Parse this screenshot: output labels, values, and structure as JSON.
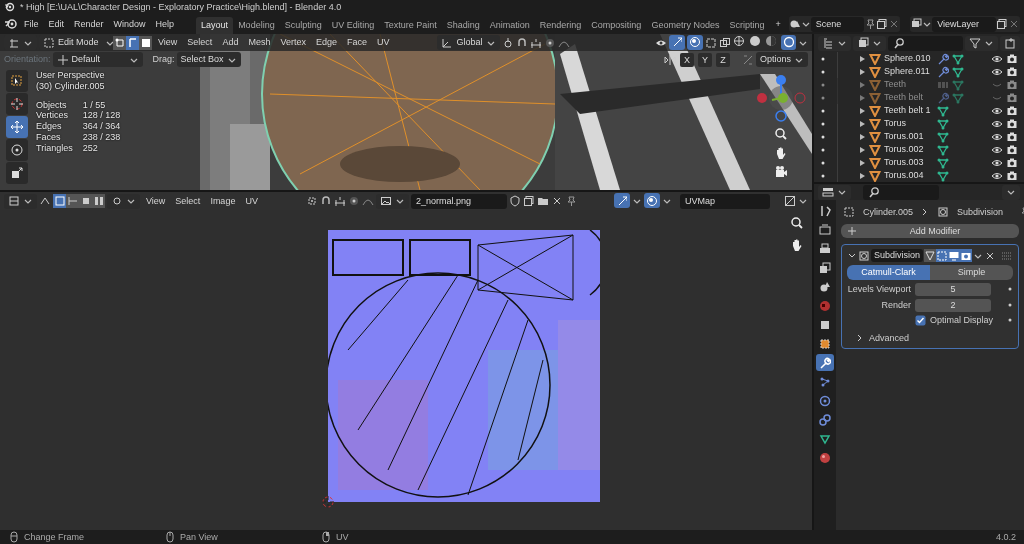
{
  "window": {
    "title": "* High [E:\\UAL\\Character Design - Exploratory Practice\\High.blend] - Blender 4.0"
  },
  "menus": [
    "File",
    "Edit",
    "Render",
    "Window",
    "Help"
  ],
  "workspaces": [
    {
      "label": "Layout",
      "selected": true
    },
    {
      "label": "Modeling",
      "selected": false
    },
    {
      "label": "Sculpting",
      "selected": false
    },
    {
      "label": "UV Editing",
      "selected": false
    },
    {
      "label": "Texture Paint",
      "selected": false
    },
    {
      "label": "Shading",
      "selected": false
    },
    {
      "label": "Animation",
      "selected": false
    },
    {
      "label": "Rendering",
      "selected": false
    },
    {
      "label": "Compositing",
      "selected": false
    },
    {
      "label": "Geometry Nodes",
      "selected": false
    },
    {
      "label": "Scripting",
      "selected": false
    }
  ],
  "add_workspace": "+",
  "scene": "Scene",
  "view_layer": "ViewLayer",
  "viewport": {
    "mode": "Edit Mode",
    "select_modes": [
      {
        "selected": false
      },
      {
        "selected": true
      },
      {
        "selected": false
      }
    ],
    "menus": [
      "View",
      "Select",
      "Add",
      "Mesh",
      "Vertex",
      "Edge",
      "Face",
      "UV"
    ],
    "transform_orientation": "Global",
    "orientation_label": "Orientation:",
    "orientation": "Default",
    "drag_label": "Drag:",
    "drag": "Select Box",
    "axes": [
      "X",
      "Y",
      "Z"
    ],
    "options": "Options",
    "view_name": "User Perspective",
    "object": "(30) Cylinder.005",
    "stats": [
      {
        "label": "Objects",
        "value": "1 / 55"
      },
      {
        "label": "Vertices",
        "value": "128 / 128"
      },
      {
        "label": "Edges",
        "value": "364 / 364"
      },
      {
        "label": "Faces",
        "value": "238 / 238"
      },
      {
        "label": "Triangles",
        "value": "252"
      }
    ],
    "tools": [
      {
        "selected": false
      },
      {
        "selected": false
      },
      {
        "selected": true
      },
      {
        "selected": false
      },
      {
        "selected": false
      }
    ]
  },
  "uv_editor": {
    "menus": [
      "View",
      "Select",
      "Image",
      "UV"
    ],
    "image": "2_normal.png",
    "uv_map": "UVMap"
  },
  "outliner": {
    "items": [
      {
        "name": "Sphere.010",
        "kind": "wrench",
        "dimmed": false,
        "visible": true
      },
      {
        "name": "Sphere.011",
        "kind": "wrench",
        "dimmed": false,
        "visible": true
      },
      {
        "name": "Teeth",
        "kind": "array",
        "dimmed": true,
        "visible": false
      },
      {
        "name": "Teeth belt",
        "kind": "wrench",
        "dimmed": true,
        "visible": false
      },
      {
        "name": "Teeth belt 1",
        "kind": "plain",
        "dimmed": false,
        "visible": true
      },
      {
        "name": "Torus",
        "kind": "plain",
        "dimmed": false,
        "visible": true
      },
      {
        "name": "Torus.001",
        "kind": "plain",
        "dimmed": false,
        "visible": true
      },
      {
        "name": "Torus.002",
        "kind": "plain",
        "dimmed": false,
        "visible": true
      },
      {
        "name": "Torus.003",
        "kind": "plain",
        "dimmed": false,
        "visible": true
      },
      {
        "name": "Torus.004",
        "kind": "plain",
        "dimmed": false,
        "visible": true
      }
    ]
  },
  "properties": {
    "tabs": [
      {
        "selected": false
      },
      {
        "selected": false
      },
      {
        "selected": false
      },
      {
        "selected": false
      },
      {
        "selected": false
      },
      {
        "selected": false
      },
      {
        "selected": false
      },
      {
        "selected": false
      },
      {
        "selected": true
      },
      {
        "selected": false
      },
      {
        "selected": false
      },
      {
        "selected": false
      },
      {
        "selected": false
      },
      {
        "selected": false
      }
    ],
    "breadcrumb": {
      "object": "Cylinder.005",
      "modifier": "Subdivision"
    },
    "add_modifier": "Add Modifier",
    "modifier": {
      "name": "Subdivision",
      "expanded": true,
      "toggles": [
        {
          "on": false
        },
        {
          "on": true
        },
        {
          "on": true
        },
        {
          "on": true
        }
      ],
      "types": [
        {
          "label": "Catmull-Clark",
          "selected": true
        },
        {
          "label": "Simple",
          "selected": false
        }
      ],
      "fields": [
        {
          "label": "Levels Viewport",
          "value": "5"
        },
        {
          "label": "Render",
          "value": "2"
        }
      ],
      "optimal_display": {
        "label": "Optimal Display",
        "checked": true
      },
      "advanced": {
        "label": "Advanced",
        "expanded": false
      }
    }
  },
  "status_bar": {
    "items": [
      "Change Frame",
      "Pan View",
      "UV"
    ],
    "version": "4.0.2"
  }
}
